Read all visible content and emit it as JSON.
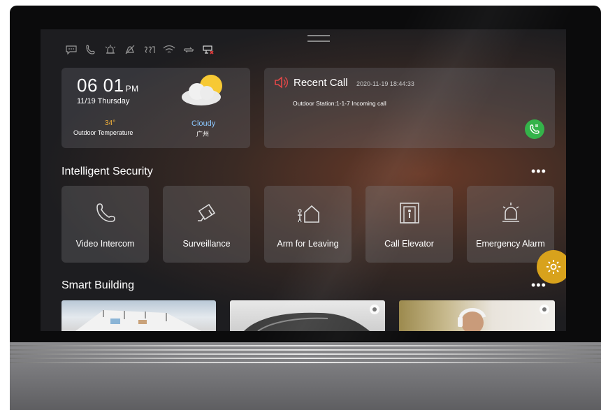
{
  "status_icons": [
    "message-icon",
    "phone-icon",
    "alarm-icon",
    "mute-icon",
    "connection-icon",
    "wifi-icon",
    "sync-icon",
    "camera-offline-icon"
  ],
  "clock": {
    "time": "06 01",
    "ampm": "PM",
    "date": "11/19  Thursday"
  },
  "temperature": {
    "value": "34°",
    "label": "Outdoor Temperature"
  },
  "weather": {
    "condition": "Cloudy",
    "city": "广州"
  },
  "recent_call": {
    "title": "Recent Call",
    "timestamp": "2020-11-19 18:44:33",
    "detail": "Outdoor Station:1-1-7 Incoming call"
  },
  "security": {
    "title": "Intelligent Security",
    "more": "•••",
    "tiles": [
      {
        "label": "Video Intercom"
      },
      {
        "label": "Surveillance"
      },
      {
        "label": "Arm for Leaving"
      },
      {
        "label": "Call Elevator"
      },
      {
        "label": "Emergency Alarm"
      }
    ]
  },
  "smart_building": {
    "title": "Smart Building",
    "more": "•••"
  },
  "colors": {
    "accent_gold": "#d8a21c",
    "call_green": "#34b34a",
    "temp_orange": "#f3b23a",
    "weather_blue": "#8cc8ff"
  }
}
